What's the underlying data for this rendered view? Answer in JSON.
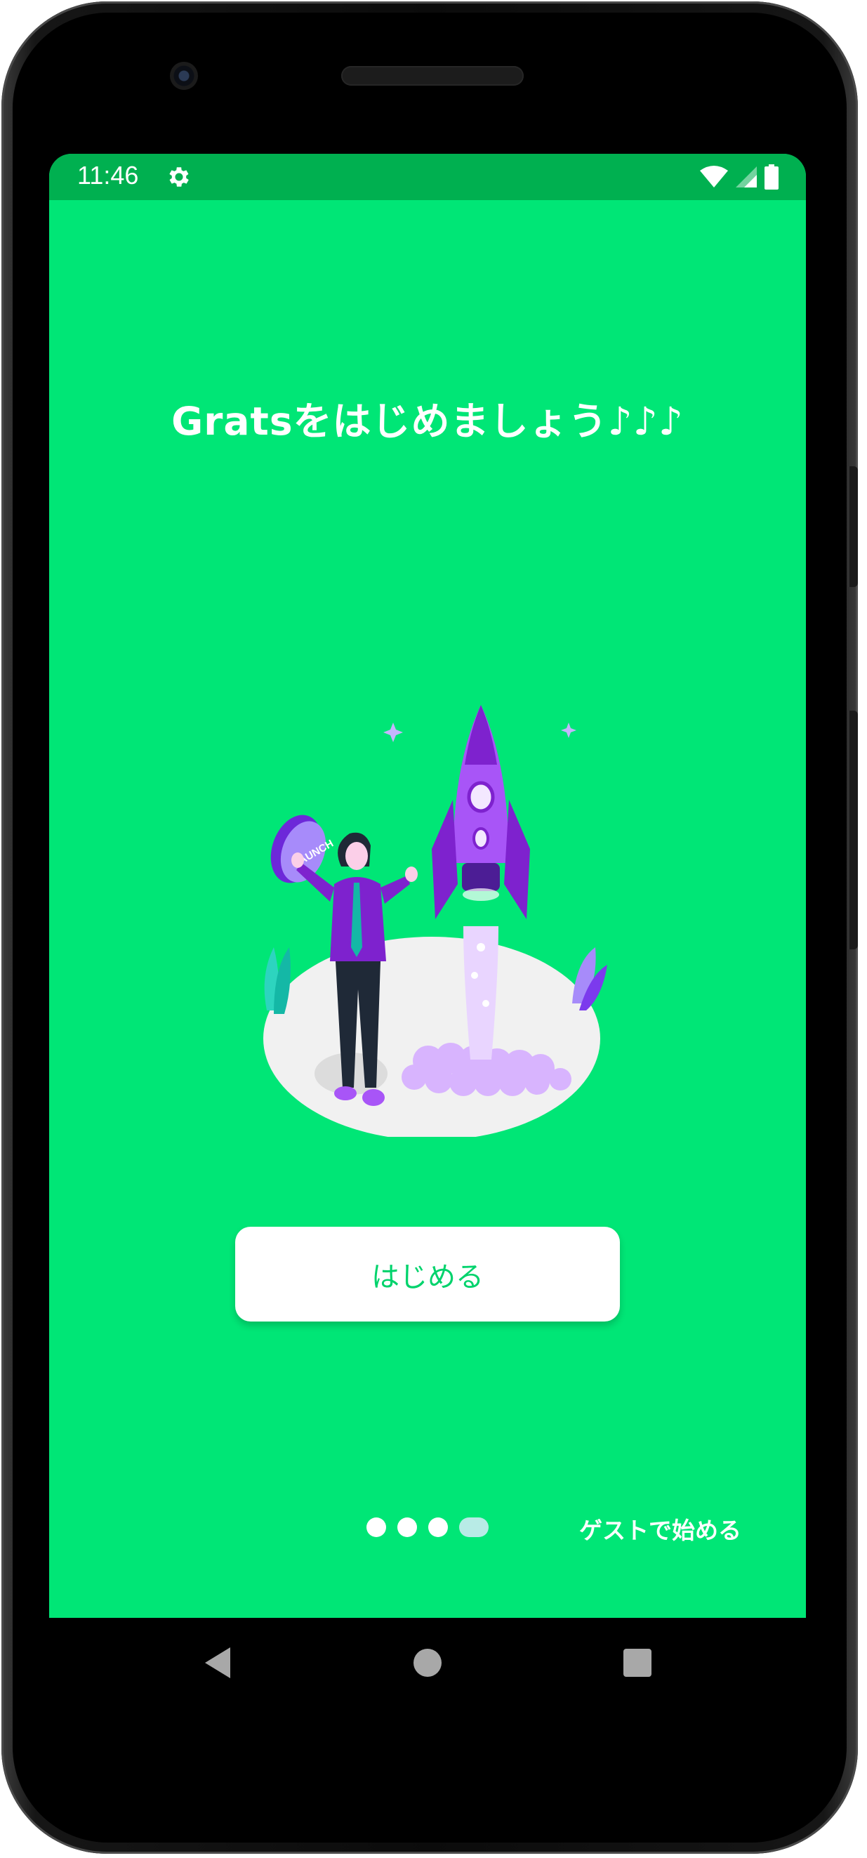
{
  "status_bar": {
    "time": "11:46",
    "settings_icon": "gear-icon",
    "icons": [
      "wifi-icon",
      "signal-icon",
      "battery-icon"
    ],
    "bg_color": "#00b050"
  },
  "screen": {
    "bg_color": "#00e676",
    "headline": "Gratsをはじめましょう♪♪♪",
    "illustration": "rocket-launch-illustration",
    "illustration_badge": "LAUNCH",
    "start_button": {
      "label": "はじめる",
      "text_color": "#00d36c"
    },
    "pager": {
      "total": 4,
      "active_index": 3
    },
    "guest_link": "ゲストで始める"
  },
  "nav_bar": {
    "items": [
      "back-icon",
      "home-icon",
      "recents-icon"
    ]
  }
}
